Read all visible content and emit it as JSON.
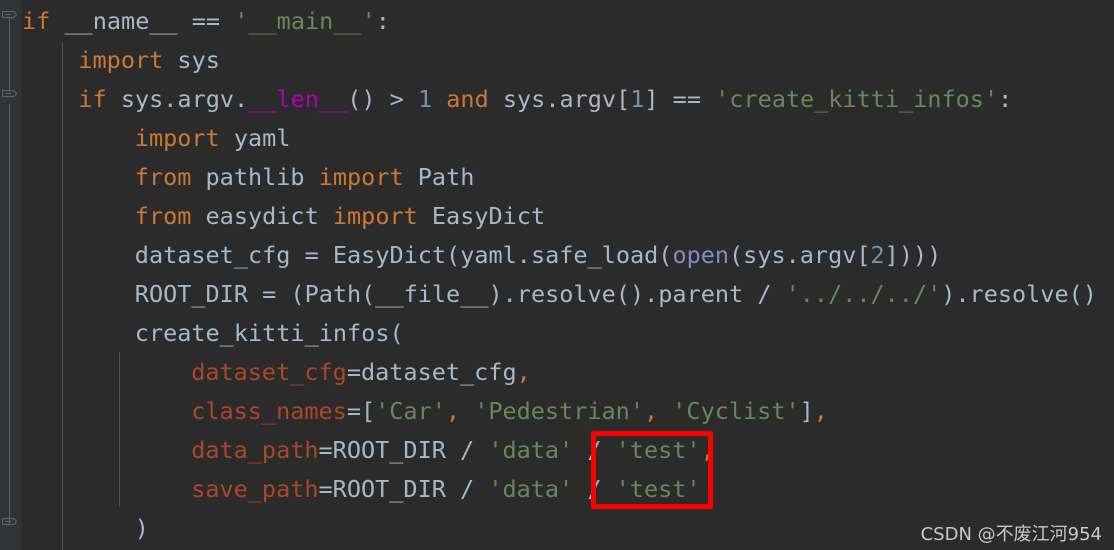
{
  "editor": {
    "theme_name": "darcula",
    "background_color": "#2b2b2b",
    "gutter_color": "#313335",
    "default_text_color": "#a9b7c6",
    "keyword_color": "#cc7832",
    "string_color": "#6a8759",
    "number_color": "#6897bb",
    "dunder_color": "#b200b2",
    "builtin_color": "#8888c6",
    "kwarg_color": "#aa4926",
    "indent_guide_color": "#4e5254",
    "fold_marker_color": "#606366"
  },
  "annotation": {
    "box_color": "#fe0000",
    "encloses": "'test', / 'test'"
  },
  "watermark": {
    "text": "CSDN @不废江河954"
  },
  "gutter": {
    "fold_markers": [
      {
        "name": "fold-marker-if-main",
        "line": 1,
        "state": "expanded"
      },
      {
        "name": "fold-marker-if-argv",
        "line": 3,
        "state": "expanded"
      },
      {
        "name": "fold-marker-block-end",
        "line": 13,
        "state": "expanded"
      }
    ]
  },
  "code": {
    "language": "python",
    "lines": [
      {
        "index": 1,
        "indent": 0,
        "text": "if __name__ == '__main__':",
        "tokens": [
          {
            "t": "if",
            "c": "kw"
          },
          {
            "t": " ",
            "c": "punct"
          },
          {
            "t": "__name__",
            "c": "ident"
          },
          {
            "t": " == ",
            "c": "punct"
          },
          {
            "t": "'__main__'",
            "c": "str"
          },
          {
            "t": ":",
            "c": "punct"
          }
        ]
      },
      {
        "index": 2,
        "indent": 1,
        "text": "import sys",
        "tokens": [
          {
            "t": "import",
            "c": "kw"
          },
          {
            "t": " sys",
            "c": "ident"
          }
        ]
      },
      {
        "index": 3,
        "indent": 1,
        "text": "if sys.argv.__len__() > 1 and sys.argv[1] == 'create_kitti_infos':",
        "tokens": [
          {
            "t": "if",
            "c": "kw"
          },
          {
            "t": " sys.argv.",
            "c": "ident"
          },
          {
            "t": "__len__",
            "c": "magic"
          },
          {
            "t": "() > ",
            "c": "punct"
          },
          {
            "t": "1",
            "c": "num"
          },
          {
            "t": " ",
            "c": "punct"
          },
          {
            "t": "and",
            "c": "kw"
          },
          {
            "t": " sys.argv[",
            "c": "ident"
          },
          {
            "t": "1",
            "c": "num"
          },
          {
            "t": "] == ",
            "c": "punct"
          },
          {
            "t": "'create_kitti_infos'",
            "c": "str"
          },
          {
            "t": ":",
            "c": "punct"
          }
        ]
      },
      {
        "index": 4,
        "indent": 2,
        "text": "import yaml",
        "tokens": [
          {
            "t": "import",
            "c": "kw"
          },
          {
            "t": " yaml",
            "c": "ident"
          }
        ]
      },
      {
        "index": 5,
        "indent": 2,
        "text": "from pathlib import Path",
        "tokens": [
          {
            "t": "from",
            "c": "kw"
          },
          {
            "t": " pathlib ",
            "c": "ident"
          },
          {
            "t": "import",
            "c": "kw"
          },
          {
            "t": " Path",
            "c": "ident"
          }
        ]
      },
      {
        "index": 6,
        "indent": 2,
        "text": "from easydict import EasyDict",
        "tokens": [
          {
            "t": "from",
            "c": "kw"
          },
          {
            "t": " easydict ",
            "c": "ident"
          },
          {
            "t": "import",
            "c": "kw"
          },
          {
            "t": " EasyDict",
            "c": "ident"
          }
        ]
      },
      {
        "index": 7,
        "indent": 2,
        "text": "dataset_cfg = EasyDict(yaml.safe_load(open(sys.argv[2])))",
        "tokens": [
          {
            "t": "dataset_cfg = EasyDict(yaml.safe_load(",
            "c": "ident"
          },
          {
            "t": "open",
            "c": "builtin"
          },
          {
            "t": "(sys.argv[",
            "c": "ident"
          },
          {
            "t": "2",
            "c": "num"
          },
          {
            "t": "])))",
            "c": "punct"
          }
        ]
      },
      {
        "index": 8,
        "indent": 2,
        "text": "ROOT_DIR = (Path(__file__).resolve().parent / '../../../').resolve()",
        "tokens": [
          {
            "t": "ROOT_DIR = (Path(__file__).resolve().parent / ",
            "c": "ident"
          },
          {
            "t": "'../../../'",
            "c": "str"
          },
          {
            "t": ").resolve()",
            "c": "ident"
          }
        ]
      },
      {
        "index": 9,
        "indent": 2,
        "text": "create_kitti_infos(",
        "tokens": [
          {
            "t": "create_kitti_infos(",
            "c": "ident"
          }
        ]
      },
      {
        "index": 10,
        "indent": 3,
        "text": "dataset_cfg=dataset_cfg,",
        "tokens": [
          {
            "t": "dataset_cfg",
            "c": "kwarg"
          },
          {
            "t": "=dataset_cfg",
            "c": "ident"
          },
          {
            "t": ",",
            "c": "comma"
          }
        ]
      },
      {
        "index": 11,
        "indent": 3,
        "text": "class_names=['Car', 'Pedestrian', 'Cyclist'],",
        "tokens": [
          {
            "t": "class_names",
            "c": "kwarg"
          },
          {
            "t": "=[",
            "c": "ident"
          },
          {
            "t": "'Car'",
            "c": "str"
          },
          {
            "t": ",",
            "c": "comma"
          },
          {
            "t": " ",
            "c": "punct"
          },
          {
            "t": "'Pedestrian'",
            "c": "str"
          },
          {
            "t": ",",
            "c": "comma"
          },
          {
            "t": " ",
            "c": "punct"
          },
          {
            "t": "'Cyclist'",
            "c": "str"
          },
          {
            "t": "]",
            "c": "ident"
          },
          {
            "t": ",",
            "c": "comma"
          }
        ]
      },
      {
        "index": 12,
        "indent": 3,
        "text": "data_path=ROOT_DIR / 'data' / 'test',",
        "tokens": [
          {
            "t": "data_path",
            "c": "kwarg"
          },
          {
            "t": "=ROOT_DIR / ",
            "c": "ident"
          },
          {
            "t": "'data'",
            "c": "str"
          },
          {
            "t": " / ",
            "c": "ident"
          },
          {
            "t": "'test'",
            "c": "str"
          },
          {
            "t": ",",
            "c": "comma"
          }
        ]
      },
      {
        "index": 13,
        "indent": 3,
        "text": "save_path=ROOT_DIR / 'data' / 'test'",
        "tokens": [
          {
            "t": "save_path",
            "c": "kwarg"
          },
          {
            "t": "=ROOT_DIR / ",
            "c": "ident"
          },
          {
            "t": "'data'",
            "c": "str"
          },
          {
            "t": " / ",
            "c": "ident"
          },
          {
            "t": "'test'",
            "c": "str"
          }
        ]
      },
      {
        "index": 14,
        "indent": 2,
        "text": ")",
        "tokens": [
          {
            "t": ")",
            "c": "punct"
          }
        ]
      }
    ]
  }
}
